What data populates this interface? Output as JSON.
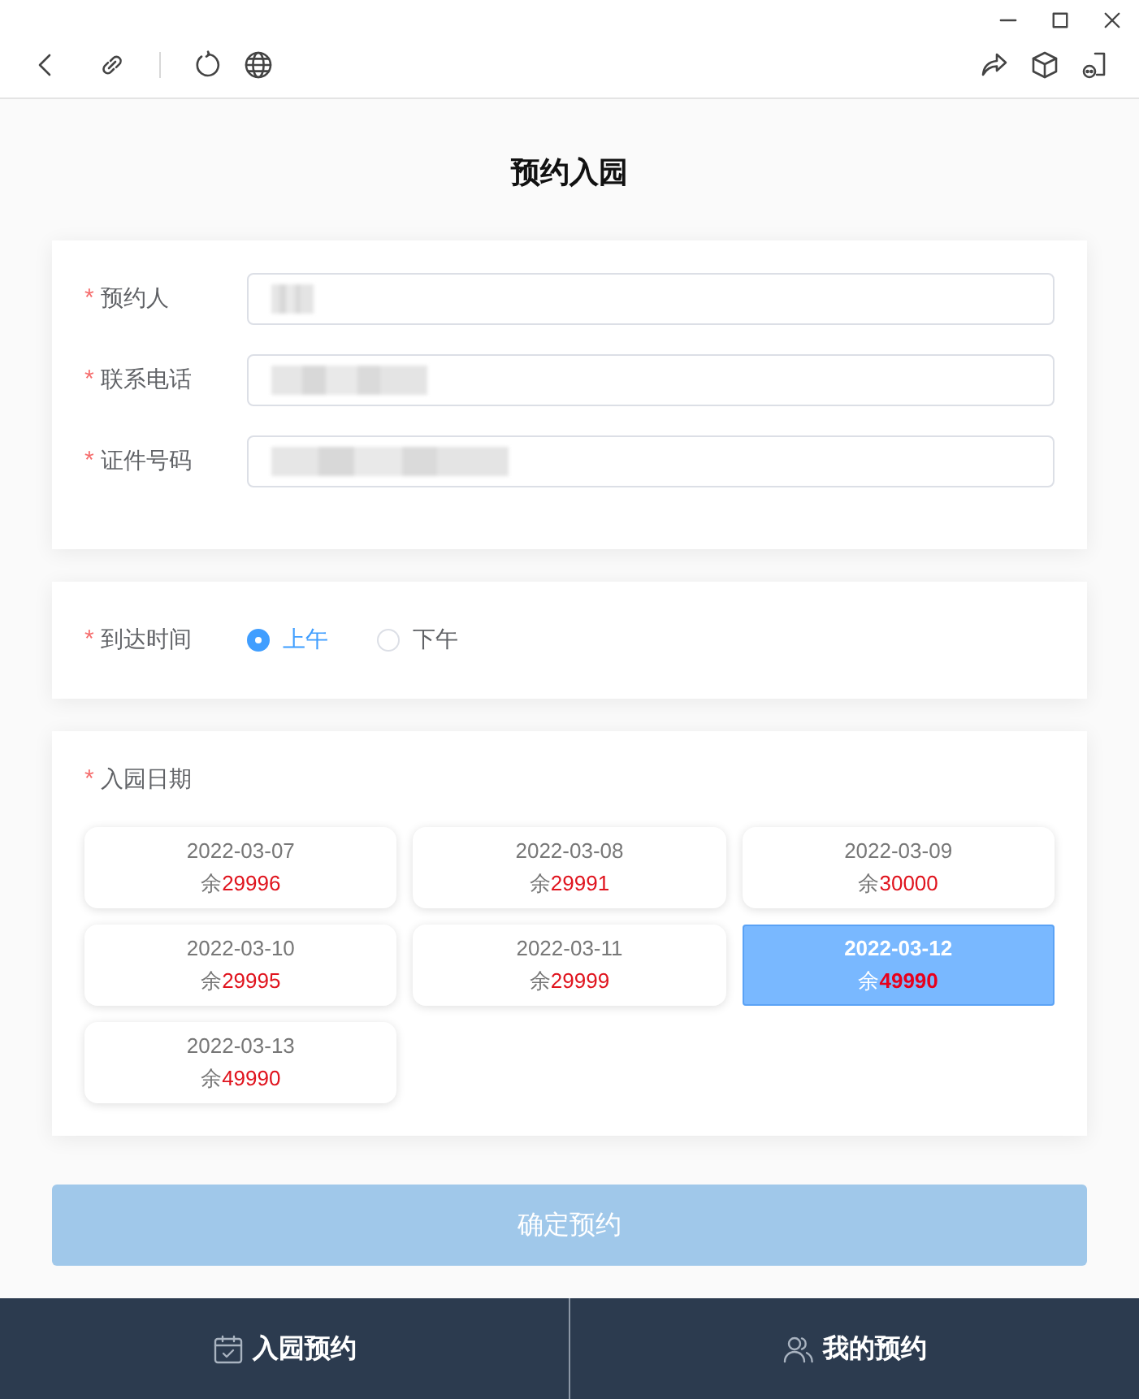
{
  "page_title": "预约入园",
  "contact_form": {
    "fields": [
      {
        "required_mark": "*",
        "label": "预约人",
        "kind": "name"
      },
      {
        "required_mark": "*",
        "label": "联系电话",
        "kind": "phone"
      },
      {
        "required_mark": "*",
        "label": "证件号码",
        "kind": "id"
      }
    ]
  },
  "arrival_time": {
    "required_mark": "*",
    "label": "到达时间",
    "options": [
      {
        "label": "上午",
        "selected": true
      },
      {
        "label": "下午",
        "selected": false
      }
    ]
  },
  "visit_date": {
    "required_mark": "*",
    "label": "入园日期",
    "slots": [
      {
        "date": "2022-03-07",
        "remaining_label": "余",
        "remaining": "29996",
        "selected": false
      },
      {
        "date": "2022-03-08",
        "remaining_label": "余",
        "remaining": "29991",
        "selected": false
      },
      {
        "date": "2022-03-09",
        "remaining_label": "余",
        "remaining": "30000",
        "selected": false
      },
      {
        "date": "2022-03-10",
        "remaining_label": "余",
        "remaining": "29995",
        "selected": false
      },
      {
        "date": "2022-03-11",
        "remaining_label": "余",
        "remaining": "29999",
        "selected": false
      },
      {
        "date": "2022-03-12",
        "remaining_label": "余",
        "remaining": "49990",
        "selected": true
      },
      {
        "date": "2022-03-13",
        "remaining_label": "余",
        "remaining": "49990",
        "selected": false
      }
    ]
  },
  "submit_button": {
    "label": "确定预约",
    "disabled": true
  },
  "bottom_nav": [
    {
      "label": "入园预约"
    },
    {
      "label": "我的预约"
    }
  ]
}
